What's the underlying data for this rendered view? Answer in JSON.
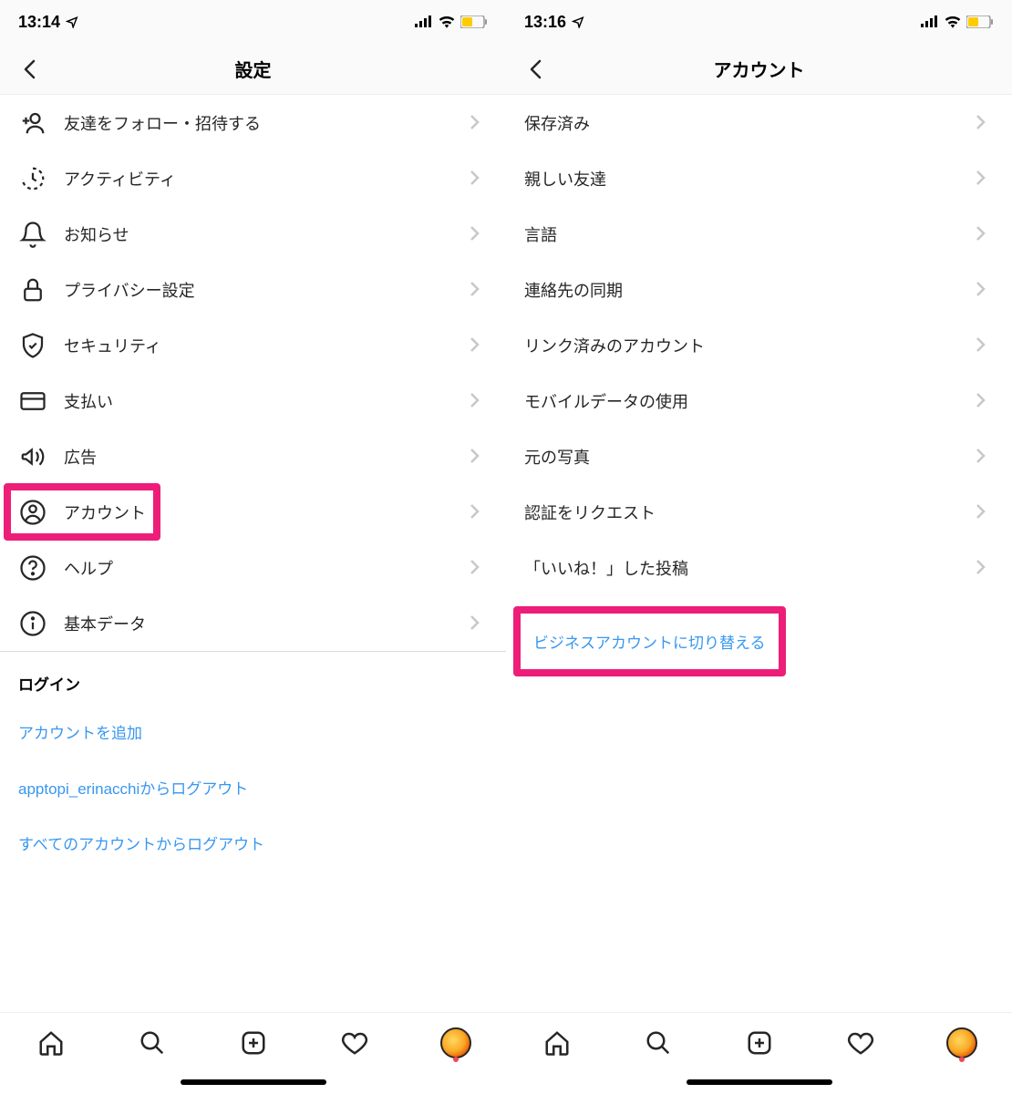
{
  "left": {
    "status": {
      "time": "13:14"
    },
    "nav": {
      "title": "設定"
    },
    "items": [
      {
        "icon": "add-person",
        "label": "友達をフォロー・招待する"
      },
      {
        "icon": "activity",
        "label": "アクティビティ"
      },
      {
        "icon": "bell",
        "label": "お知らせ"
      },
      {
        "icon": "lock",
        "label": "プライバシー設定"
      },
      {
        "icon": "shield",
        "label": "セキュリティ"
      },
      {
        "icon": "card",
        "label": "支払い"
      },
      {
        "icon": "megaphone",
        "label": "広告"
      },
      {
        "icon": "person-circle",
        "label": "アカウント",
        "highlight": true
      },
      {
        "icon": "help",
        "label": "ヘルプ"
      },
      {
        "icon": "info",
        "label": "基本データ"
      }
    ],
    "login_header": "ログイン",
    "login_links": [
      "アカウントを追加",
      "apptopi_erinacchiからログアウト",
      "すべてのアカウントからログアウト"
    ]
  },
  "right": {
    "status": {
      "time": "13:16"
    },
    "nav": {
      "title": "アカウント"
    },
    "items": [
      {
        "label": "保存済み"
      },
      {
        "label": "親しい友達"
      },
      {
        "label": "言語"
      },
      {
        "label": "連絡先の同期"
      },
      {
        "label": "リンク済みのアカウント"
      },
      {
        "label": "モバイルデータの使用"
      },
      {
        "label": "元の写真"
      },
      {
        "label": "認証をリクエスト"
      },
      {
        "label": "「いいね！」した投稿"
      }
    ],
    "switch_link": "ビジネスアカウントに切り替える"
  }
}
